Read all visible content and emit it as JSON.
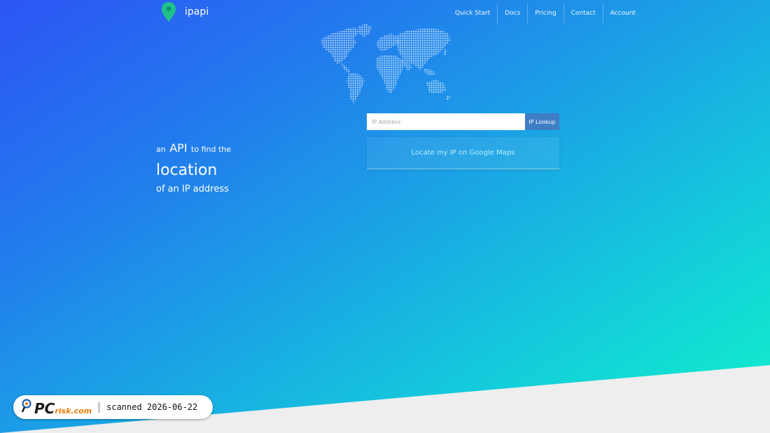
{
  "brand": {
    "name": "ipapi",
    "pin_color": "#1ec28a"
  },
  "nav": {
    "items": [
      {
        "label": "Quick Start"
      },
      {
        "label": "Docs"
      },
      {
        "label": "Pricing"
      },
      {
        "label": "Contact"
      },
      {
        "label": "Account"
      }
    ]
  },
  "hero": {
    "line1_prefix": "an",
    "line1_api": "API",
    "line1_suffix": "to find the",
    "line2": "location",
    "line3": "of an IP address"
  },
  "search": {
    "placeholder": "IP Address",
    "value": "",
    "button_label": "IP Lookup",
    "button_color": "#3f7dc4"
  },
  "locate": {
    "label": "Locate my IP on Google Maps"
  },
  "watermark": {
    "logo_pc": "PC",
    "logo_risk": "risk.com",
    "text": "scanned 2026-06-22"
  }
}
